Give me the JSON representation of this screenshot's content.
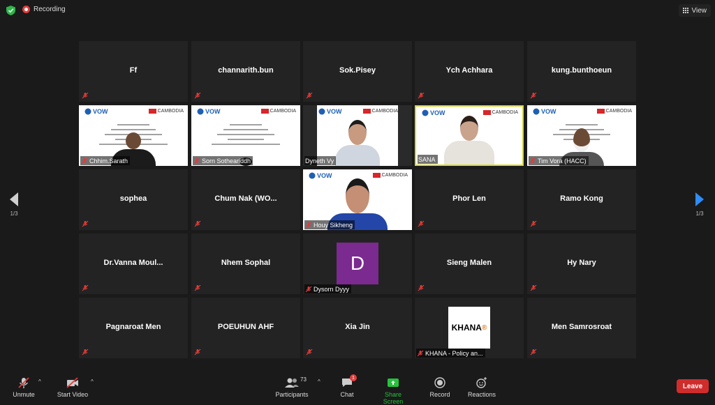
{
  "topbar": {
    "recording_label": "Recording",
    "view_label": "View"
  },
  "nav": {
    "left_page": "1/3",
    "right_page": "1/3"
  },
  "row1": [
    "Ff",
    "channarith.bun",
    "Sok.Pisey",
    "Ych Achhara",
    "kung.bunthoeun"
  ],
  "row2": [
    "Chhim.Sarath",
    "Sorn Sotheariddh",
    "Dyneth Vy",
    "SANA",
    "Tim Vora (HACC)"
  ],
  "row3": [
    "sophea",
    "Chum  Nak  (WO...",
    "Houy Sikheng",
    "Phor Len",
    "Ramo Kong"
  ],
  "row4": [
    "Dr.Vanna  Moul...",
    "Nhem Sophal",
    "Dysorn Dyyy",
    "Sieng Malen",
    "Hy Nary"
  ],
  "row5": [
    "Pagnaroat Men",
    "POEUHUN  AHF",
    "Xia Jin",
    "KHANA - Policy an...",
    "Men Samrosroat"
  ],
  "slide": {
    "vow": "VOW",
    "cambodia": "CAMBODIA"
  },
  "avatar_letter": "D",
  "khana_logo": {
    "main": "KHANA",
    "mark": "®"
  },
  "toolbar": {
    "unmute": "Unmute",
    "start_video": "Start Video",
    "participants": "Participants",
    "participant_count": "73",
    "chat": "Chat",
    "chat_badge": "1",
    "share": "Share Screen",
    "record": "Record",
    "reactions": "Reactions",
    "leave": "Leave"
  },
  "colors": {
    "leave": "#d12c2c",
    "share": "#27c23b",
    "active_border": "#d8d63a",
    "muted": "#e23b3b"
  }
}
